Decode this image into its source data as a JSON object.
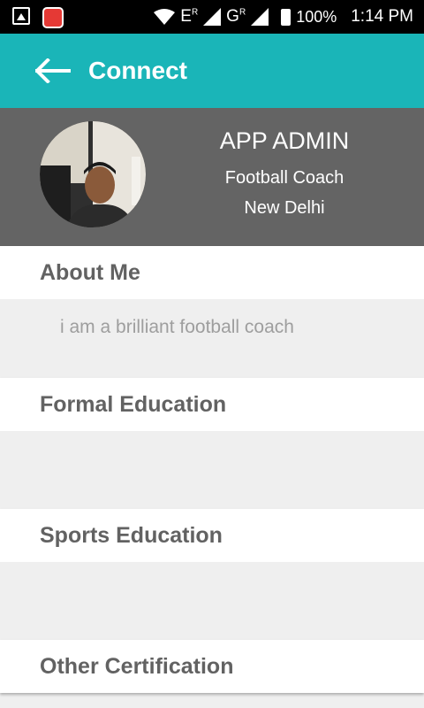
{
  "status_bar": {
    "network1": "E",
    "network1_sup": "R",
    "network2": "G",
    "network2_sup": "R",
    "battery": "100%",
    "time": "1:14 PM"
  },
  "appbar": {
    "title": "Connect"
  },
  "profile": {
    "name": "APP ADMIN",
    "role": "Football Coach",
    "city": "New Delhi"
  },
  "sections": {
    "about": {
      "title": "About Me",
      "text": "i am a brilliant football coach"
    },
    "formal": {
      "title": "Formal Education",
      "text": ""
    },
    "sports": {
      "title": "Sports Education",
      "text": ""
    },
    "other": {
      "title": "Other Certification"
    }
  },
  "colors": {
    "primary": "#1ab5b8",
    "header_bg": "#646464",
    "page_bg": "#efefef"
  }
}
